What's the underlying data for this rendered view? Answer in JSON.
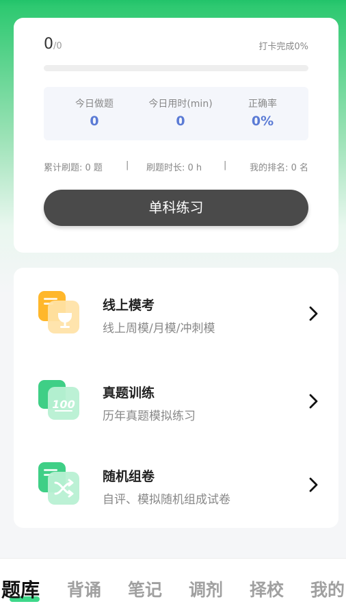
{
  "progress": {
    "done": "0",
    "total": "/0",
    "checkin": "打卡完成0%",
    "fraction": 0
  },
  "stats": [
    {
      "label": "今日做题",
      "value": "0"
    },
    {
      "label": "今日用时(min)",
      "value": "0"
    },
    {
      "label": "正确率",
      "value": "0%"
    }
  ],
  "summary": {
    "total_questions": "累计刷题: 0 题",
    "separator": "|",
    "duration": "刷题时长: 0 h",
    "rank": "我的排名: 0 名"
  },
  "practice_button": "单科练习",
  "features": [
    {
      "title": "线上模考",
      "subtitle": "线上周模/月模/冲刺模",
      "icon": "trophy-icon"
    },
    {
      "title": "真题训练",
      "subtitle": "历年真题模拟练习",
      "icon": "exam-100-icon"
    },
    {
      "title": "随机组卷",
      "subtitle": "自评、模拟随机组成试卷",
      "icon": "shuffle-icon"
    }
  ],
  "tabs": [
    {
      "label": "题库",
      "active": true
    },
    {
      "label": "背诵",
      "active": false
    },
    {
      "label": "笔记",
      "active": false
    },
    {
      "label": "调剂",
      "active": false
    },
    {
      "label": "择校",
      "active": false
    },
    {
      "label": "我的",
      "active": false
    }
  ],
  "colors": {
    "brand_green": "#22c36a",
    "stat_blue": "#5b7bd5",
    "button_dark": "#4a4a4a"
  }
}
